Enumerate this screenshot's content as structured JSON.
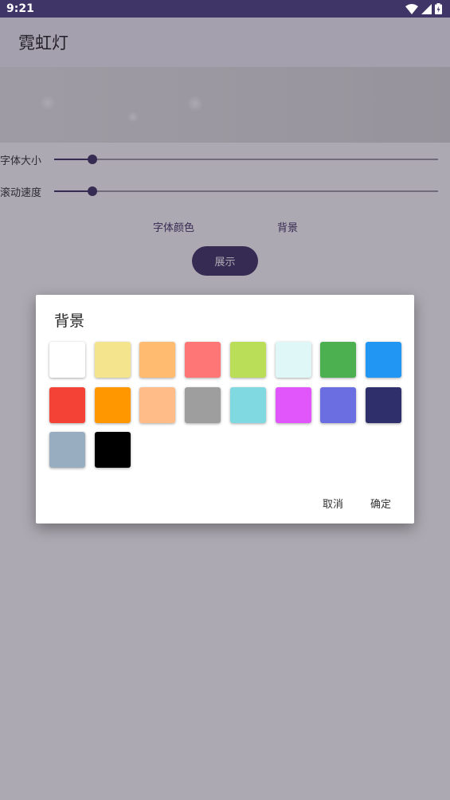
{
  "status_bar": {
    "time": "9:21"
  },
  "app_bar": {
    "title": "霓虹灯"
  },
  "controls": {
    "font_size_label": "字体大小",
    "font_size_value": 0.1,
    "scroll_speed_label": "滚动速度",
    "scroll_speed_value": 0.1,
    "font_color_label": "字体颜色",
    "background_label": "背景",
    "show_label": "展示"
  },
  "dialog": {
    "title": "背景",
    "cancel_label": "取消",
    "ok_label": "确定",
    "colors": [
      "#ffffff",
      "#f5e48e",
      "#ffbb70",
      "#ff7676",
      "#bade58",
      "#e0f7f8",
      "#4caf50",
      "#2196f3",
      "#f44336",
      "#ff9800",
      "#ffbc88",
      "#9e9e9e",
      "#80d8e0",
      "#e056fa",
      "#6b6ee0",
      "#2e2f6b",
      "#98aec0",
      "#000000"
    ]
  }
}
